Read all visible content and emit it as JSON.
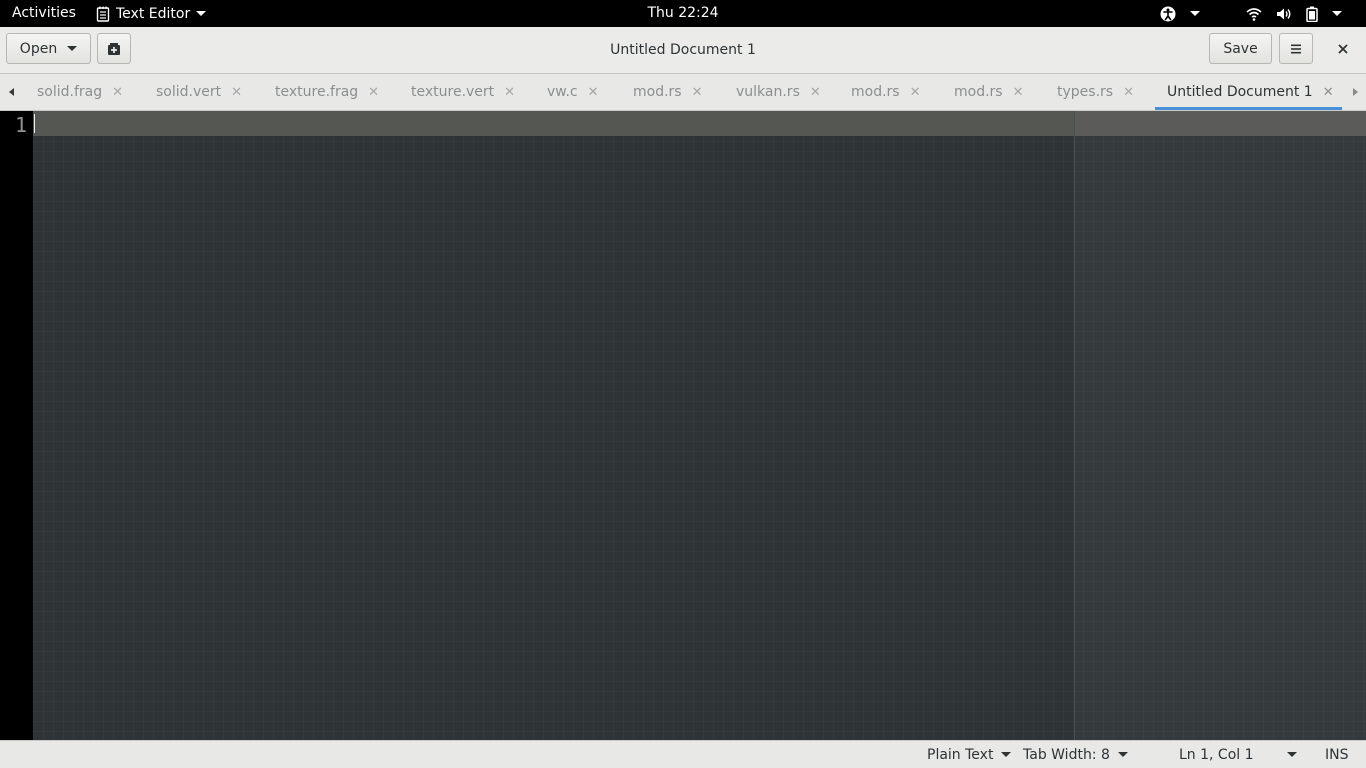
{
  "topbar": {
    "activities": "Activities",
    "app_name": "Text Editor",
    "clock": "Thu 22:24",
    "tray_icons": [
      "accessibility-icon",
      "wifi-icon",
      "volume-icon",
      "battery-icon"
    ]
  },
  "header": {
    "open_label": "Open",
    "title": "Untitled Document 1",
    "save_label": "Save"
  },
  "tabs": [
    {
      "label": "solid.frag",
      "active": false
    },
    {
      "label": "solid.vert",
      "active": false
    },
    {
      "label": "texture.frag",
      "active": false
    },
    {
      "label": "texture.vert",
      "active": false
    },
    {
      "label": "vw.c",
      "active": false
    },
    {
      "label": "mod.rs",
      "active": false
    },
    {
      "label": "vulkan.rs",
      "active": false
    },
    {
      "label": "mod.rs",
      "active": false
    },
    {
      "label": "mod.rs",
      "active": false
    },
    {
      "label": "types.rs",
      "active": false
    },
    {
      "label": "Untitled Document 1",
      "active": true
    }
  ],
  "editor": {
    "line_number": "1",
    "content": ""
  },
  "status": {
    "language": "Plain Text",
    "tab_width": "Tab Width: 8",
    "position": "Ln 1, Col 1",
    "mode": "INS"
  },
  "colors": {
    "editor_bg": "#2e3436",
    "current_line": "#555753",
    "active_tab_accent": "#4a90d9"
  }
}
